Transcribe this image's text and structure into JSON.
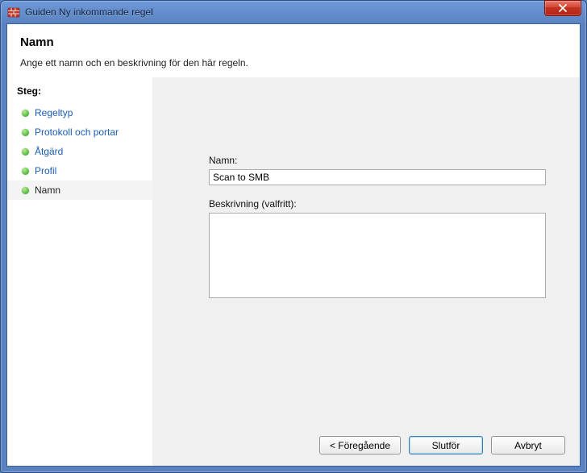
{
  "window": {
    "title": "Guiden Ny inkommande regel"
  },
  "header": {
    "title": "Namn",
    "subtitle": "Ange ett namn och en beskrivning för den här regeln."
  },
  "sidebar": {
    "title": "Steg:",
    "steps": [
      {
        "label": "Regeltyp",
        "current": false
      },
      {
        "label": "Protokoll och portar",
        "current": false
      },
      {
        "label": "Åtgärd",
        "current": false
      },
      {
        "label": "Profil",
        "current": false
      },
      {
        "label": "Namn",
        "current": true
      }
    ]
  },
  "form": {
    "name_label": "Namn:",
    "name_value": "Scan to SMB",
    "desc_label": "Beskrivning (valfritt):",
    "desc_value": ""
  },
  "buttons": {
    "back": "< Föregående",
    "finish": "Slutför",
    "cancel": "Avbryt"
  }
}
